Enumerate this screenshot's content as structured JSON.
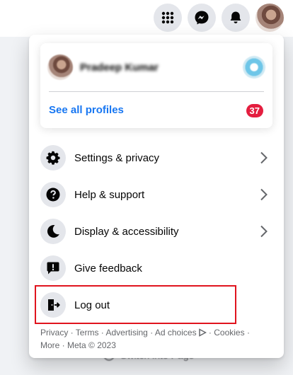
{
  "topbar": {
    "buttons": [
      {
        "name": "menu-grid",
        "icon": "grid-icon"
      },
      {
        "name": "messenger",
        "icon": "messenger-icon"
      },
      {
        "name": "notifications",
        "icon": "bell-icon"
      }
    ]
  },
  "profile_card": {
    "name": "Pradeep Kumar",
    "see_all_label": "See all profiles",
    "badge_count": "37"
  },
  "menu_items": [
    {
      "label": "Settings & privacy",
      "icon": "gear-icon",
      "has_chevron": true
    },
    {
      "label": "Help & support",
      "icon": "question-icon",
      "has_chevron": true
    },
    {
      "label": "Display & accessibility",
      "icon": "moon-icon",
      "has_chevron": true
    },
    {
      "label": "Give feedback",
      "icon": "feedback-icon",
      "has_chevron": false
    },
    {
      "label": "Log out",
      "icon": "logout-icon",
      "has_chevron": false
    }
  ],
  "footer": {
    "links": [
      "Privacy",
      "Terms",
      "Advertising",
      "Ad choices",
      "Cookies",
      "More"
    ],
    "copyright": "Meta © 2023",
    "separator": " · "
  },
  "behind": {
    "text": "Switch into Page"
  },
  "colors": {
    "accent": "#1877f2",
    "badge": "#e41e3f",
    "highlight": "#e0141e",
    "icon_bg": "#e4e6eb"
  }
}
